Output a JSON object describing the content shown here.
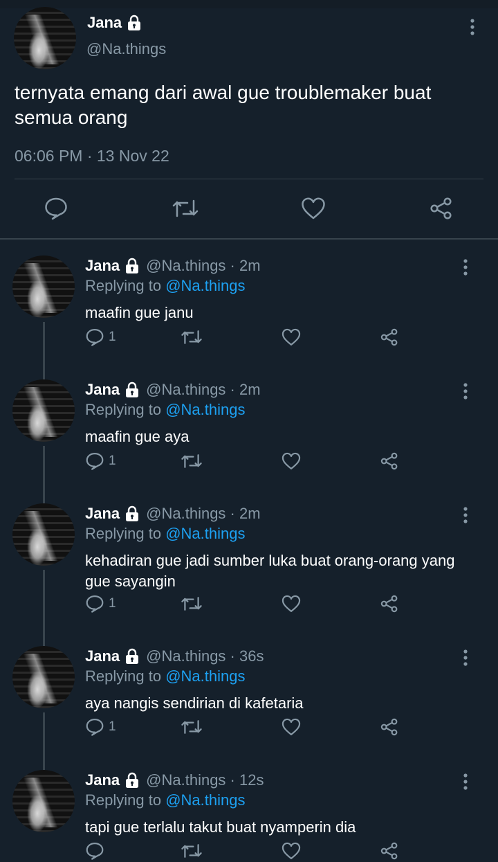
{
  "main_tweet": {
    "name": "Jana",
    "handle": "@Na.things",
    "text": "ternyata emang dari awal gue troublemaker buat semua orang",
    "timestamp": "06:06 PM · 13 Nov 22",
    "actions": [
      "reply-icon",
      "retweet-icon",
      "like-icon",
      "share-icon"
    ]
  },
  "replies": [
    {
      "name": "Jana",
      "handle_time": "@Na.things · 2m",
      "replying_prefix": "Replying to ",
      "replying_to": "@Na.things",
      "text": "maafin gue janu",
      "reply_count": "1"
    },
    {
      "name": "Jana",
      "handle_time": "@Na.things · 2m",
      "replying_prefix": "Replying to ",
      "replying_to": "@Na.things",
      "text": "maafin gue aya",
      "reply_count": "1"
    },
    {
      "name": "Jana",
      "handle_time": "@Na.things · 2m",
      "replying_prefix": "Replying to ",
      "replying_to": "@Na.things",
      "text": "kehadiran gue jadi sumber luka buat orang-orang yang gue sayangin",
      "reply_count": "1"
    },
    {
      "name": "Jana",
      "handle_time": "@Na.things · 36s",
      "replying_prefix": "Replying to ",
      "replying_to": "@Na.things",
      "text": "aya nangis sendirian di kafetaria",
      "reply_count": "1"
    },
    {
      "name": "Jana",
      "handle_time": "@Na.things · 12s",
      "replying_prefix": "Replying to ",
      "replying_to": "@Na.things",
      "text": "tapi gue terlalu takut buat nyamperin dia",
      "reply_count": ""
    }
  ],
  "colors": {
    "background": "#15202b",
    "secondary_text": "#8899a6",
    "link": "#1da1f2",
    "divider": "#38444d"
  }
}
